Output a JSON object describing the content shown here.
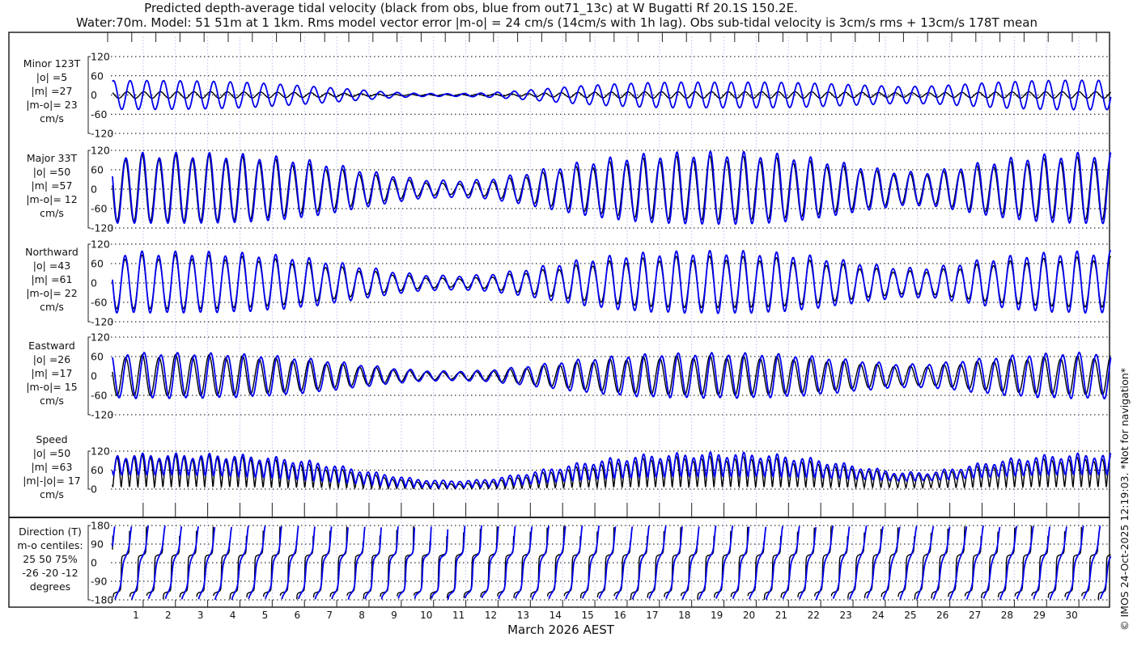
{
  "chart_data": {
    "type": "line",
    "title": [
      "Predicted depth-average tidal velocity (black from obs, blue from out71_13c) at W Bugatti Rf 20.1S 150.2E.",
      "Water:70m. Model: 51 51m at 1 1km. Rms model vector error |m-o| = 24 cm/s (14cm/s with 1h lag). Obs sub-tidal velocity is 3cm/s rms + 13cm/s 178T mean"
    ],
    "xlabel": "March 2026 AEST",
    "x_ticks": [
      "1",
      "2",
      "3",
      "4",
      "5",
      "6",
      "7",
      "8",
      "9",
      "10",
      "11",
      "12",
      "13",
      "14",
      "15",
      "16",
      "17",
      "18",
      "19",
      "20",
      "21",
      "22",
      "23",
      "24",
      "25",
      "26",
      "27",
      "28",
      "29",
      "30"
    ],
    "xlim_days": [
      0,
      31
    ],
    "credit": "© IMOS 24-Oct-2025 12:19:03. *Not for navigation*",
    "legend": {
      "obs": "black",
      "model": "blue"
    },
    "colors": {
      "obs": "#000000",
      "model": "#0000ee",
      "grid": "#000000",
      "day_grid": "#c8d0f0"
    },
    "tidal_period_hours": 12.42,
    "major_axis_deg_true": 33,
    "panels": [
      {
        "key": "minor",
        "labels": [
          "Minor 123T",
          "|o| =5",
          "|m| =27",
          "|m-o|= 23",
          "cm/s"
        ],
        "yticks": [
          "120",
          "60",
          "0",
          "-60",
          "-120"
        ],
        "ylim": [
          -120,
          120
        ]
      },
      {
        "key": "major",
        "labels": [
          "Major 33T",
          "|o| =50",
          "|m| =57",
          "|m-o|= 12",
          "cm/s"
        ],
        "yticks": [
          "120",
          "60",
          "0",
          "-60",
          "-120"
        ],
        "ylim": [
          -120,
          120
        ]
      },
      {
        "key": "north",
        "labels": [
          "Northward",
          "|o| =43",
          "|m| =61",
          "|m-o|= 22",
          "cm/s"
        ],
        "yticks": [
          "120",
          "60",
          "0",
          "-60",
          "-120"
        ],
        "ylim": [
          -120,
          120
        ]
      },
      {
        "key": "east",
        "labels": [
          "Eastward",
          "|o| =26",
          "|m| =17",
          "|m-o|= 15",
          "cm/s"
        ],
        "yticks": [
          "120",
          "60",
          "0",
          "-60",
          "-120"
        ],
        "ylim": [
          -120,
          120
        ]
      },
      {
        "key": "speed",
        "labels": [
          "Speed",
          "|o| =50",
          "|m| =63",
          "|m|-|o|= 17",
          "cm/s"
        ],
        "yticks": [
          "120",
          "60",
          "0"
        ],
        "ylim": [
          0,
          120
        ]
      },
      {
        "key": "direction",
        "labels": [
          "Direction (T)",
          "m-o centiles:",
          "25  50  75%",
          "-26 -20 -12",
          "degrees"
        ],
        "yticks": [
          "180",
          "90",
          "0",
          "-90",
          "-180"
        ],
        "ylim": [
          -180,
          180
        ]
      }
    ],
    "daily_amplitude_cm_s": {
      "model_major": [
        105,
        105,
        105,
        104,
        100,
        92,
        80,
        62,
        45,
        30,
        25,
        28,
        42,
        60,
        78,
        92,
        102,
        106,
        108,
        108,
        104,
        95,
        80,
        64,
        50,
        52,
        70,
        86,
        98,
        104,
        106
      ],
      "obs_major": [
        100,
        100,
        100,
        98,
        92,
        82,
        68,
        52,
        36,
        22,
        16,
        20,
        34,
        50,
        66,
        80,
        90,
        95,
        96,
        95,
        92,
        84,
        70,
        56,
        44,
        46,
        62,
        76,
        86,
        92,
        94
      ],
      "model_minor": [
        45,
        45,
        44,
        42,
        38,
        32,
        25,
        18,
        10,
        5,
        4,
        6,
        12,
        20,
        28,
        34,
        38,
        40,
        40,
        40,
        40,
        38,
        34,
        30,
        26,
        28,
        34,
        40,
        44,
        46,
        46
      ],
      "obs_minor": [
        10,
        10,
        10,
        10,
        9,
        8,
        7,
        5,
        3,
        2,
        2,
        3,
        4,
        6,
        8,
        9,
        10,
        10,
        10,
        10,
        10,
        10,
        9,
        8,
        7,
        7,
        8,
        9,
        10,
        10,
        10
      ]
    }
  }
}
